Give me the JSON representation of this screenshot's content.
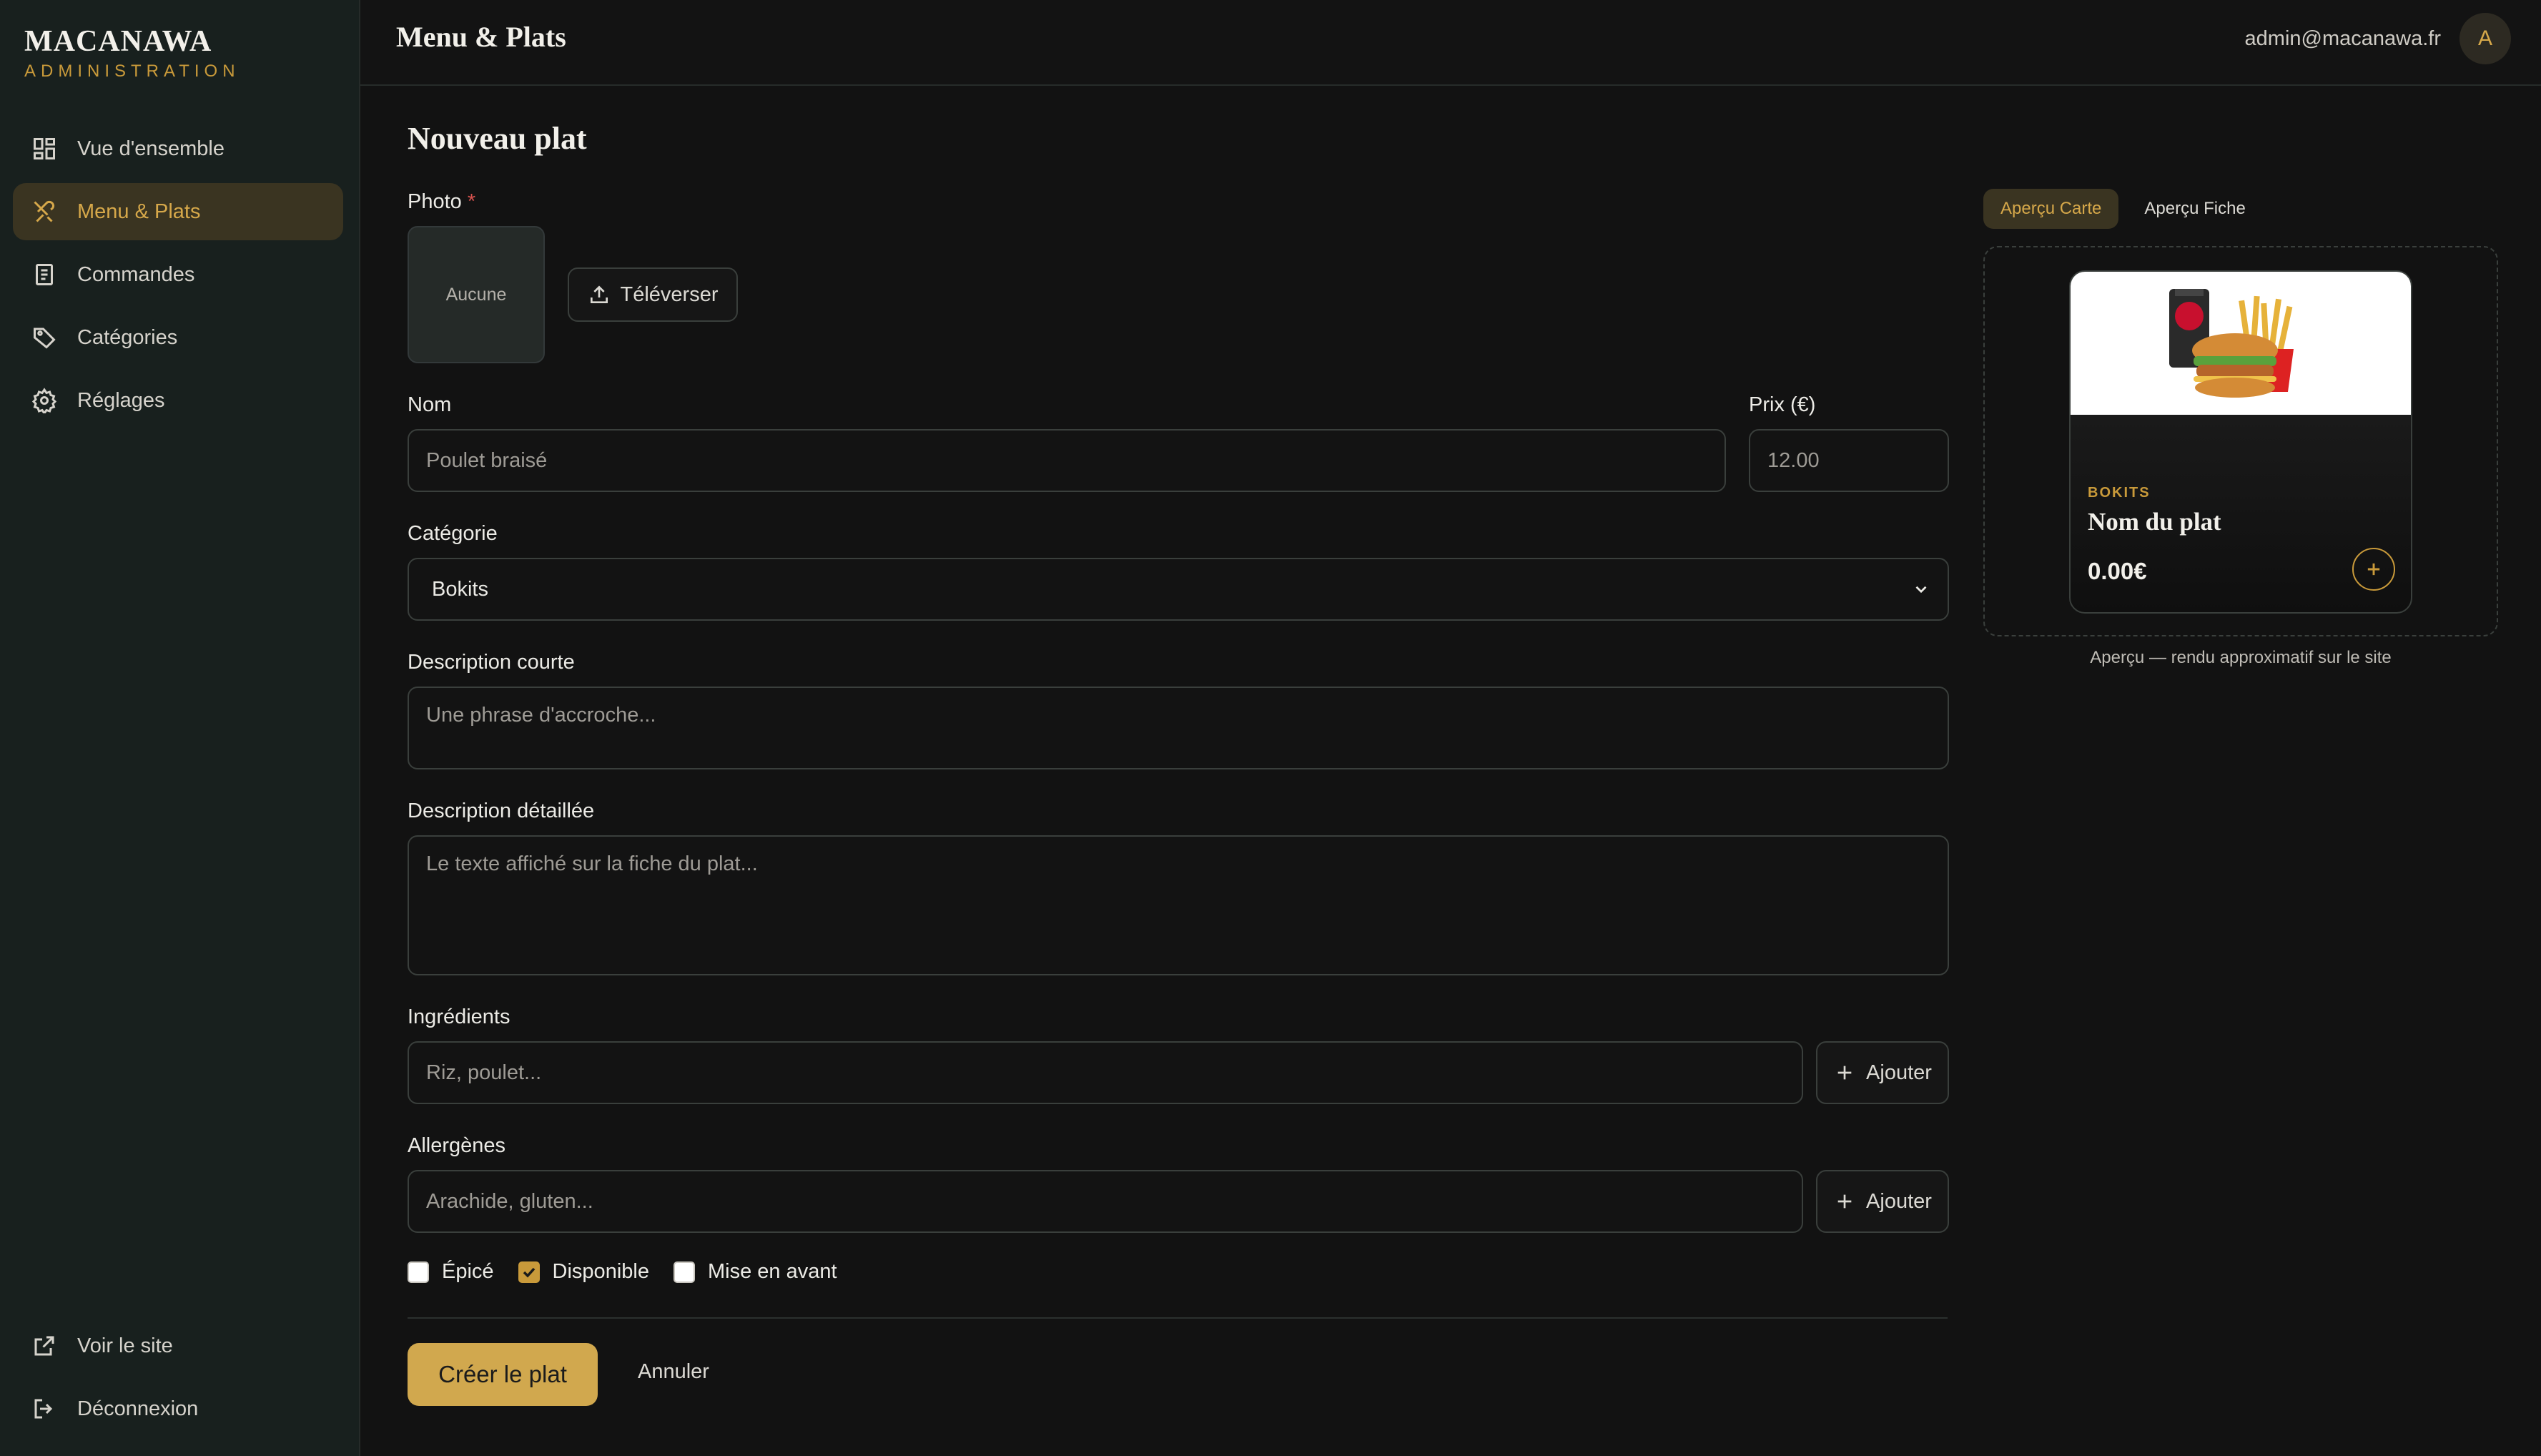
{
  "brand": {
    "name": "MACANAWA",
    "subtitle": "ADMINISTRATION"
  },
  "sidebar": {
    "items": [
      {
        "label": "Vue d'ensemble",
        "icon": "dashboard-icon",
        "active": false
      },
      {
        "label": "Menu & Plats",
        "icon": "utensils-icon",
        "active": true
      },
      {
        "label": "Commandes",
        "icon": "receipt-icon",
        "active": false
      },
      {
        "label": "Catégories",
        "icon": "tag-icon",
        "active": false
      },
      {
        "label": "Réglages",
        "icon": "gear-icon",
        "active": false
      }
    ],
    "bottom": [
      {
        "label": "Voir le site",
        "icon": "external-link-icon"
      },
      {
        "label": "Déconnexion",
        "icon": "logout-icon"
      }
    ]
  },
  "header": {
    "title": "Menu & Plats",
    "user_email": "admin@macanawa.fr",
    "avatar_initial": "A"
  },
  "form": {
    "title": "Nouveau plat",
    "photo": {
      "label": "Photo",
      "required_mark": "*",
      "empty_text": "Aucune",
      "upload_label": "Téléverser"
    },
    "name": {
      "label": "Nom",
      "placeholder": "Poulet braisé"
    },
    "price": {
      "label": "Prix (€)",
      "placeholder": "12.00"
    },
    "category": {
      "label": "Catégorie",
      "value": "Bokits"
    },
    "short_desc": {
      "label": "Description courte",
      "placeholder": "Une phrase d'accroche..."
    },
    "long_desc": {
      "label": "Description détaillée",
      "placeholder": "Le texte affiché sur la fiche du plat..."
    },
    "ingredients": {
      "label": "Ingrédients",
      "placeholder": "Riz, poulet...",
      "add_label": "Ajouter"
    },
    "allergens": {
      "label": "Allergènes",
      "placeholder": "Arachide, gluten...",
      "add_label": "Ajouter"
    },
    "checkboxes": [
      {
        "label": "Épicé",
        "checked": false
      },
      {
        "label": "Disponible",
        "checked": true
      },
      {
        "label": "Mise en avant",
        "checked": false
      }
    ],
    "submit_label": "Créer le plat",
    "cancel_label": "Annuler"
  },
  "preview": {
    "tabs": [
      {
        "label": "Aperçu Carte",
        "active": true
      },
      {
        "label": "Aperçu Fiche",
        "active": false
      }
    ],
    "card": {
      "category": "BOKITS",
      "name": "Nom du plat",
      "price": "0.00€"
    },
    "note": "Aperçu — rendu approximatif sur le site"
  },
  "colors": {
    "accent": "#c99a3a",
    "primary_button": "#d1a84e",
    "background": "#121212",
    "sidebar": "#18201e"
  }
}
